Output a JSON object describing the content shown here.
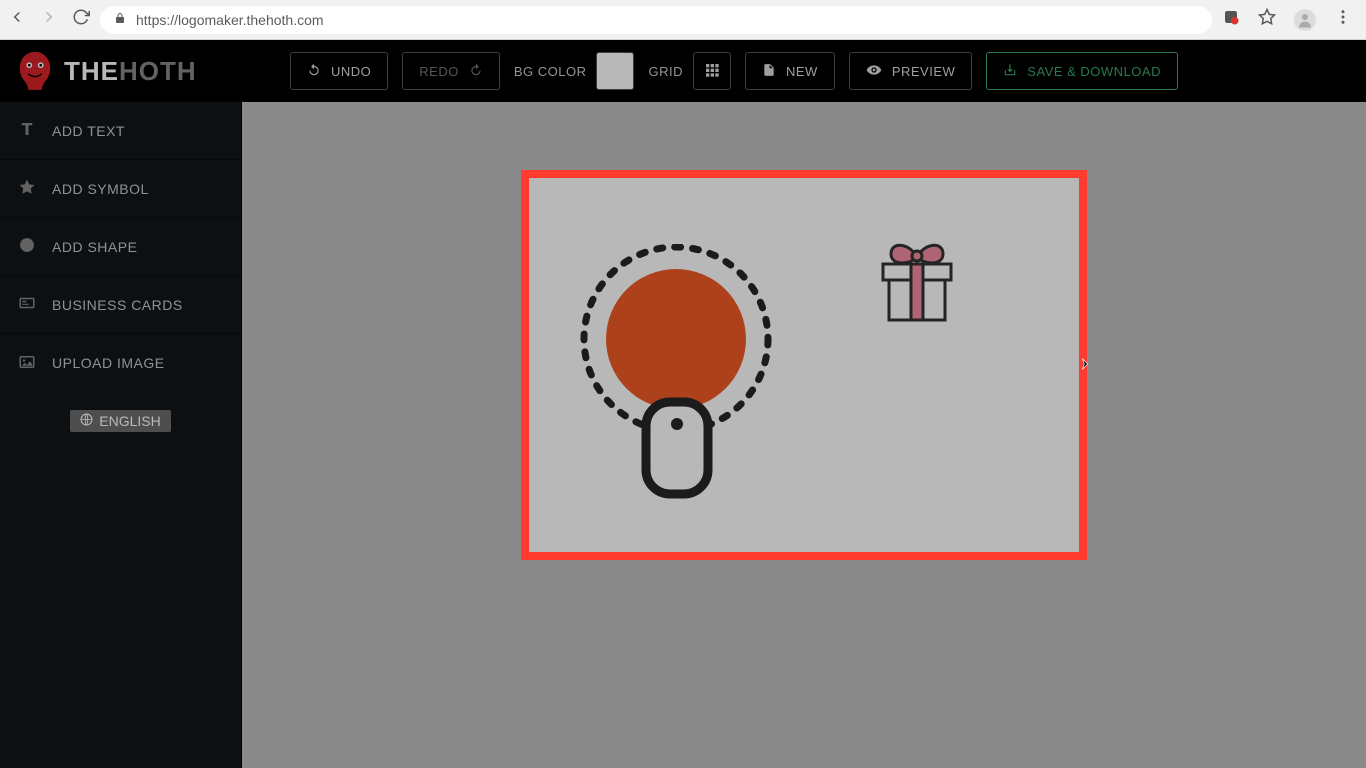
{
  "browser": {
    "url": "https://logomaker.thehoth.com"
  },
  "logo": {
    "part1": "THE",
    "part2": "HOTH"
  },
  "toolbar": {
    "undo": "UNDO",
    "redo": "REDO",
    "bgcolor_label": "BG COLOR",
    "bgcolor_value": "#ffffff",
    "grid_label": "GRID",
    "new": "NEW",
    "preview": "PREVIEW",
    "save": "SAVE & DOWNLOAD"
  },
  "sidebar": {
    "items": [
      {
        "label": "ADD TEXT",
        "icon": "text-icon"
      },
      {
        "label": "ADD SYMBOL",
        "icon": "star-icon"
      },
      {
        "label": "ADD SHAPE",
        "icon": "circle-icon"
      },
      {
        "label": "BUSINESS CARDS",
        "icon": "card-icon"
      },
      {
        "label": "UPLOAD IMAGE",
        "icon": "image-icon"
      }
    ],
    "language": "ENGLISH"
  },
  "canvas": {
    "selected": true,
    "bg": "#ffffff",
    "elements": {
      "paddle_color": "#f05a28",
      "gift_accent": "#f28ba0"
    }
  }
}
